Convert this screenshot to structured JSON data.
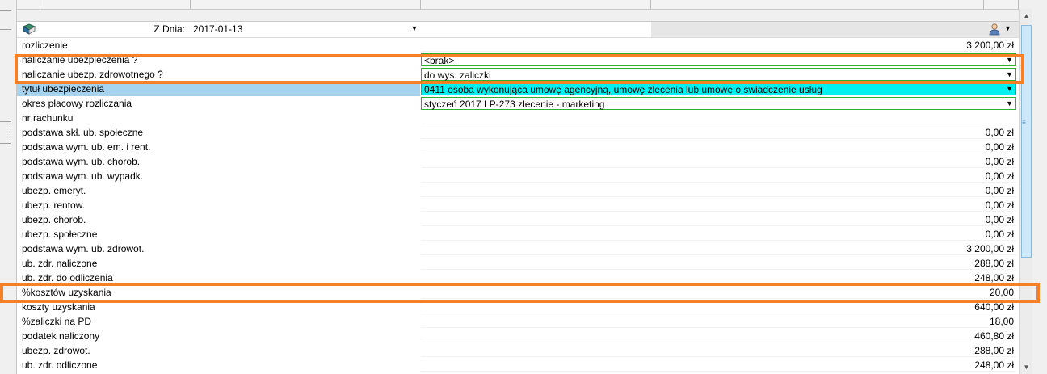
{
  "toolbar": {
    "date_label": "Z Dnia:",
    "date_value": "2017-01-13",
    "date_dropdown_icon": "dropdown-arrow-icon",
    "book_icon": "book-icon",
    "user_icon": "user-icon"
  },
  "rows": [
    {
      "name": "rozliczenie",
      "value": "3 200,00 zł",
      "kind": "num"
    },
    {
      "name": "naliczanie ubezpieczenia ?",
      "value": "<brak>",
      "kind": "combo"
    },
    {
      "name": "naliczanie ubezp. zdrowotnego ?",
      "value": "do wys. zaliczki",
      "kind": "combo"
    },
    {
      "name": "tytuł ubezpieczenia",
      "value": "0411 osoba wykonująca umowę agencyjną, umowę zlecenia lub umowę o świadczenie usług",
      "kind": "combo",
      "highlight": true
    },
    {
      "name": "okres płacowy rozliczania",
      "value": "styczeń 2017 LP-273 zlecenie - marketing",
      "kind": "combo"
    },
    {
      "name": "nr rachunku",
      "value": "",
      "kind": "num"
    },
    {
      "name": "podstawa skł. ub. społeczne",
      "value": "0,00 zł",
      "kind": "num"
    },
    {
      "name": "podstawa wym. ub. em. i rent.",
      "value": "0,00 zł",
      "kind": "num"
    },
    {
      "name": "podstawa wym. ub. chorob.",
      "value": "0,00 zł",
      "kind": "num"
    },
    {
      "name": "podstawa wym. ub. wypadk.",
      "value": "0,00 zł",
      "kind": "num"
    },
    {
      "name": "ubezp. emeryt.",
      "value": "0,00 zł",
      "kind": "num"
    },
    {
      "name": "ubezp. rentow.",
      "value": "0,00 zł",
      "kind": "num"
    },
    {
      "name": "ubezp. chorob.",
      "value": "0,00 zł",
      "kind": "num"
    },
    {
      "name": "ubezp. społeczne",
      "value": "0,00 zł",
      "kind": "num"
    },
    {
      "name": "podstawa wym. ub. zdrowot.",
      "value": "3 200,00 zł",
      "kind": "num"
    },
    {
      "name": "ub. zdr. naliczone",
      "value": "288,00 zł",
      "kind": "num"
    },
    {
      "name": "ub. zdr. do odliczenia",
      "value": "248,00 zł",
      "kind": "num"
    },
    {
      "name": "%kosztów uzyskania",
      "value": "20,00",
      "kind": "num"
    },
    {
      "name": "koszty uzyskania",
      "value": "640,00 zł",
      "kind": "num"
    },
    {
      "name": "%zaliczki na PD",
      "value": "18,00",
      "kind": "num"
    },
    {
      "name": "podatek naliczony",
      "value": "460,80 zł",
      "kind": "num"
    },
    {
      "name": "ubezp. zdrowot.",
      "value": "288,00 zł",
      "kind": "num"
    },
    {
      "name": "ub. zdr. odliczone",
      "value": "248,00 zł",
      "kind": "num"
    }
  ],
  "annotation_color": "#f58025",
  "highlight_colors": {
    "name_bg": "#a6d4ee",
    "value_bg": "#00f0f0",
    "combo_border": "#2cb22c"
  }
}
